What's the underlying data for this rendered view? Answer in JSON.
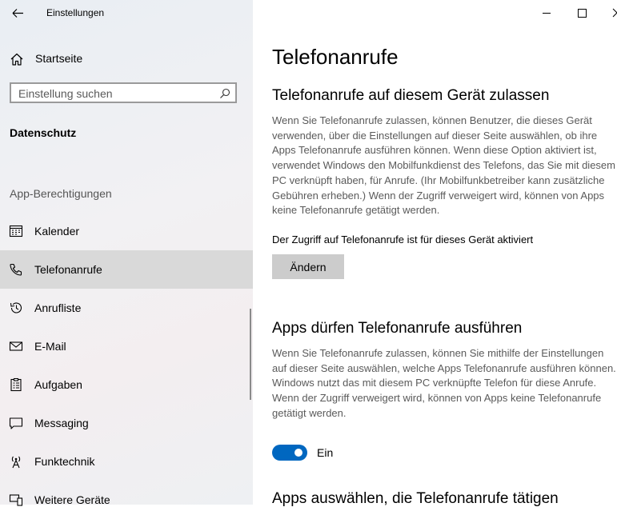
{
  "window": {
    "title": "Einstellungen"
  },
  "sidebar": {
    "home_label": "Startseite",
    "search_placeholder": "Einstellung suchen",
    "section_heading": "Datenschutz",
    "group_heading": "App-Berechtigungen",
    "items": [
      {
        "label": "Kalender",
        "icon": "calendar-icon"
      },
      {
        "label": "Telefonanrufe",
        "icon": "phone-icon",
        "selected": true
      },
      {
        "label": "Anrufliste",
        "icon": "history-icon"
      },
      {
        "label": "E-Mail",
        "icon": "mail-icon"
      },
      {
        "label": "Aufgaben",
        "icon": "clipboard-icon"
      },
      {
        "label": "Messaging",
        "icon": "chat-icon"
      },
      {
        "label": "Funktechnik",
        "icon": "antenna-icon"
      },
      {
        "label": "Weitere Geräte",
        "icon": "devices-icon"
      }
    ]
  },
  "main": {
    "page_title": "Telefonanrufe",
    "device_section": {
      "heading": "Telefonanrufe auf diesem Gerät zulassen",
      "description": "Wenn Sie Telefonanrufe zulassen, können Benutzer, die dieses Gerät verwenden, über die Einstellungen auf dieser Seite auswählen, ob ihre Apps Telefonanrufe ausführen können. Wenn diese Option aktiviert ist, verwendet Windows den Mobilfunkdienst des Telefons, das Sie mit diesem PC verknüpft haben, für Anrufe. (Ihr Mobilfunkbetreiber kann zusätzliche Gebühren erheben.) Wenn der Zugriff verweigert wird, können von Apps keine Telefonanrufe getätigt werden.",
      "status": "Der Zugriff auf Telefonanrufe ist für dieses Gerät aktiviert",
      "button_label": "Ändern"
    },
    "apps_section": {
      "heading": "Apps dürfen Telefonanrufe ausführen",
      "description": "Wenn Sie Telefonanrufe zulassen, können Sie mithilfe der Einstellungen auf dieser Seite auswählen, welche Apps Telefonanrufe ausführen können. Windows nutzt das mit diesem PC verknüpfte Telefon für diese Anrufe. Wenn der Zugriff verweigert wird, können von Apps keine Telefonanrufe getätigt werden.",
      "toggle_on": true,
      "toggle_label": "Ein"
    },
    "choose_section": {
      "heading": "Apps auswählen, die Telefonanrufe tätigen"
    }
  },
  "colors": {
    "accent": "#0067c0",
    "selected_bg": "#d9d9d9",
    "button_bg": "#cccccc",
    "description_text": "#5a5a5a"
  }
}
